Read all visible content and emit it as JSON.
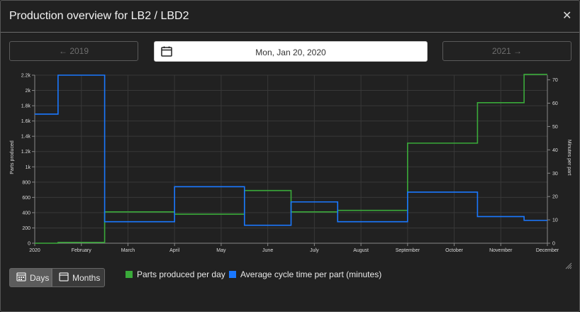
{
  "dialog": {
    "title": "Production overview for LB2 / LBD2",
    "close_icon": "close-icon"
  },
  "nav": {
    "prev_label": "← 2019",
    "next_label": "2021 →",
    "date_value": "Mon, Jan 20, 2020",
    "calendar_icon": "calendar-icon"
  },
  "toggle": {
    "days_label": "Days",
    "months_label": "Months",
    "active": "Days"
  },
  "legend": {
    "parts_label": "Parts produced per day",
    "cycle_label": "Average cycle time per part (minutes)"
  },
  "colors": {
    "parts": "#3aaa3a",
    "cycle": "#1a78ff",
    "grid": "#383838",
    "axis_text": "#dcdcdc"
  },
  "chart_data": {
    "type": "line",
    "step": true,
    "x_ticks": [
      "2020",
      "February",
      "March",
      "April",
      "May",
      "June",
      "July",
      "August",
      "September",
      "October",
      "November",
      "December"
    ],
    "ylabel_left": "Parts produced",
    "ylabel_right": "Minutes per part",
    "ylim_left": [
      0,
      2200
    ],
    "ylim_right": [
      0,
      72
    ],
    "y_ticks_left": [
      "0",
      "200",
      "400",
      "600",
      "800",
      "1k",
      "1.2k",
      "1.4k",
      "1.6k",
      "1.8k",
      "2k",
      "2.2k"
    ],
    "y_ticks_right": [
      "0",
      "10",
      "20",
      "30",
      "40",
      "50",
      "60",
      "70"
    ],
    "grid": true,
    "series": [
      {
        "name": "Parts produced per day",
        "axis": "left",
        "steps": [
          {
            "from": 0.0,
            "to": 0.5,
            "value": 0
          },
          {
            "from": 0.5,
            "to": 1.5,
            "value": 10
          },
          {
            "from": 1.5,
            "to": 3.0,
            "value": 410
          },
          {
            "from": 3.0,
            "to": 4.5,
            "value": 380
          },
          {
            "from": 4.5,
            "to": 5.5,
            "value": 690
          },
          {
            "from": 5.5,
            "to": 6.5,
            "value": 410
          },
          {
            "from": 6.5,
            "to": 8.0,
            "value": 430
          },
          {
            "from": 8.0,
            "to": 9.5,
            "value": 1310
          },
          {
            "from": 9.5,
            "to": 10.5,
            "value": 1840
          },
          {
            "from": 10.5,
            "to": 11.0,
            "value": 2210
          }
        ]
      },
      {
        "name": "Average cycle time per part (minutes)",
        "axis": "right",
        "steps": [
          {
            "from": 0.0,
            "to": 0.5,
            "value": 55.3
          },
          {
            "from": 0.5,
            "to": 1.5,
            "value": 72
          },
          {
            "from": 1.5,
            "to": 3.0,
            "value": 9.2
          },
          {
            "from": 3.0,
            "to": 4.5,
            "value": 24.2
          },
          {
            "from": 4.5,
            "to": 5.5,
            "value": 7.7
          },
          {
            "from": 5.5,
            "to": 6.5,
            "value": 17.7
          },
          {
            "from": 6.5,
            "to": 8.0,
            "value": 9.2
          },
          {
            "from": 8.0,
            "to": 9.5,
            "value": 21.9
          },
          {
            "from": 9.5,
            "to": 10.5,
            "value": 11.4
          },
          {
            "from": 10.5,
            "to": 11.0,
            "value": 9.8
          }
        ]
      }
    ]
  }
}
